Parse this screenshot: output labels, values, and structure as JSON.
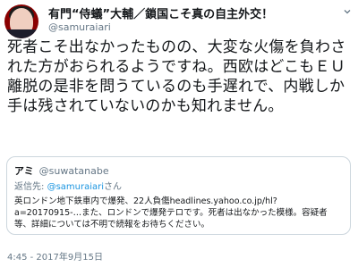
{
  "author": {
    "display_name": "有門“侍蟻”大輔／鎖国こそ真の自主外交！",
    "handle": "@samuraiari"
  },
  "tweet": {
    "text": "死者こそ出なかったものの、大変な火傷を負わされた方がおられるようですね。西欧はどこもＥＵ離脱の是非を問うているのも手遅れで、内戦しか手は残されていないのかも知れません。",
    "timestamp": "4:45 - 2017年9月15日"
  },
  "quoted": {
    "display_name": "アミ",
    "handle": "@suwatanabe",
    "reply_prefix": "返信先: ",
    "reply_to": "@samuraiari",
    "reply_suffix": "さん",
    "text": "英ロンドン地下鉄車内で爆発、22人負傷headlines.yahoo.co.jp/hl?a=20170915-…また、ロンドンで爆発テロです。死者は出なかった模様。容疑者等、詳細については不明で続報をお待ちください。"
  },
  "icons": {
    "caret": "chevron-down-icon",
    "avatar": "profile-avatar"
  }
}
